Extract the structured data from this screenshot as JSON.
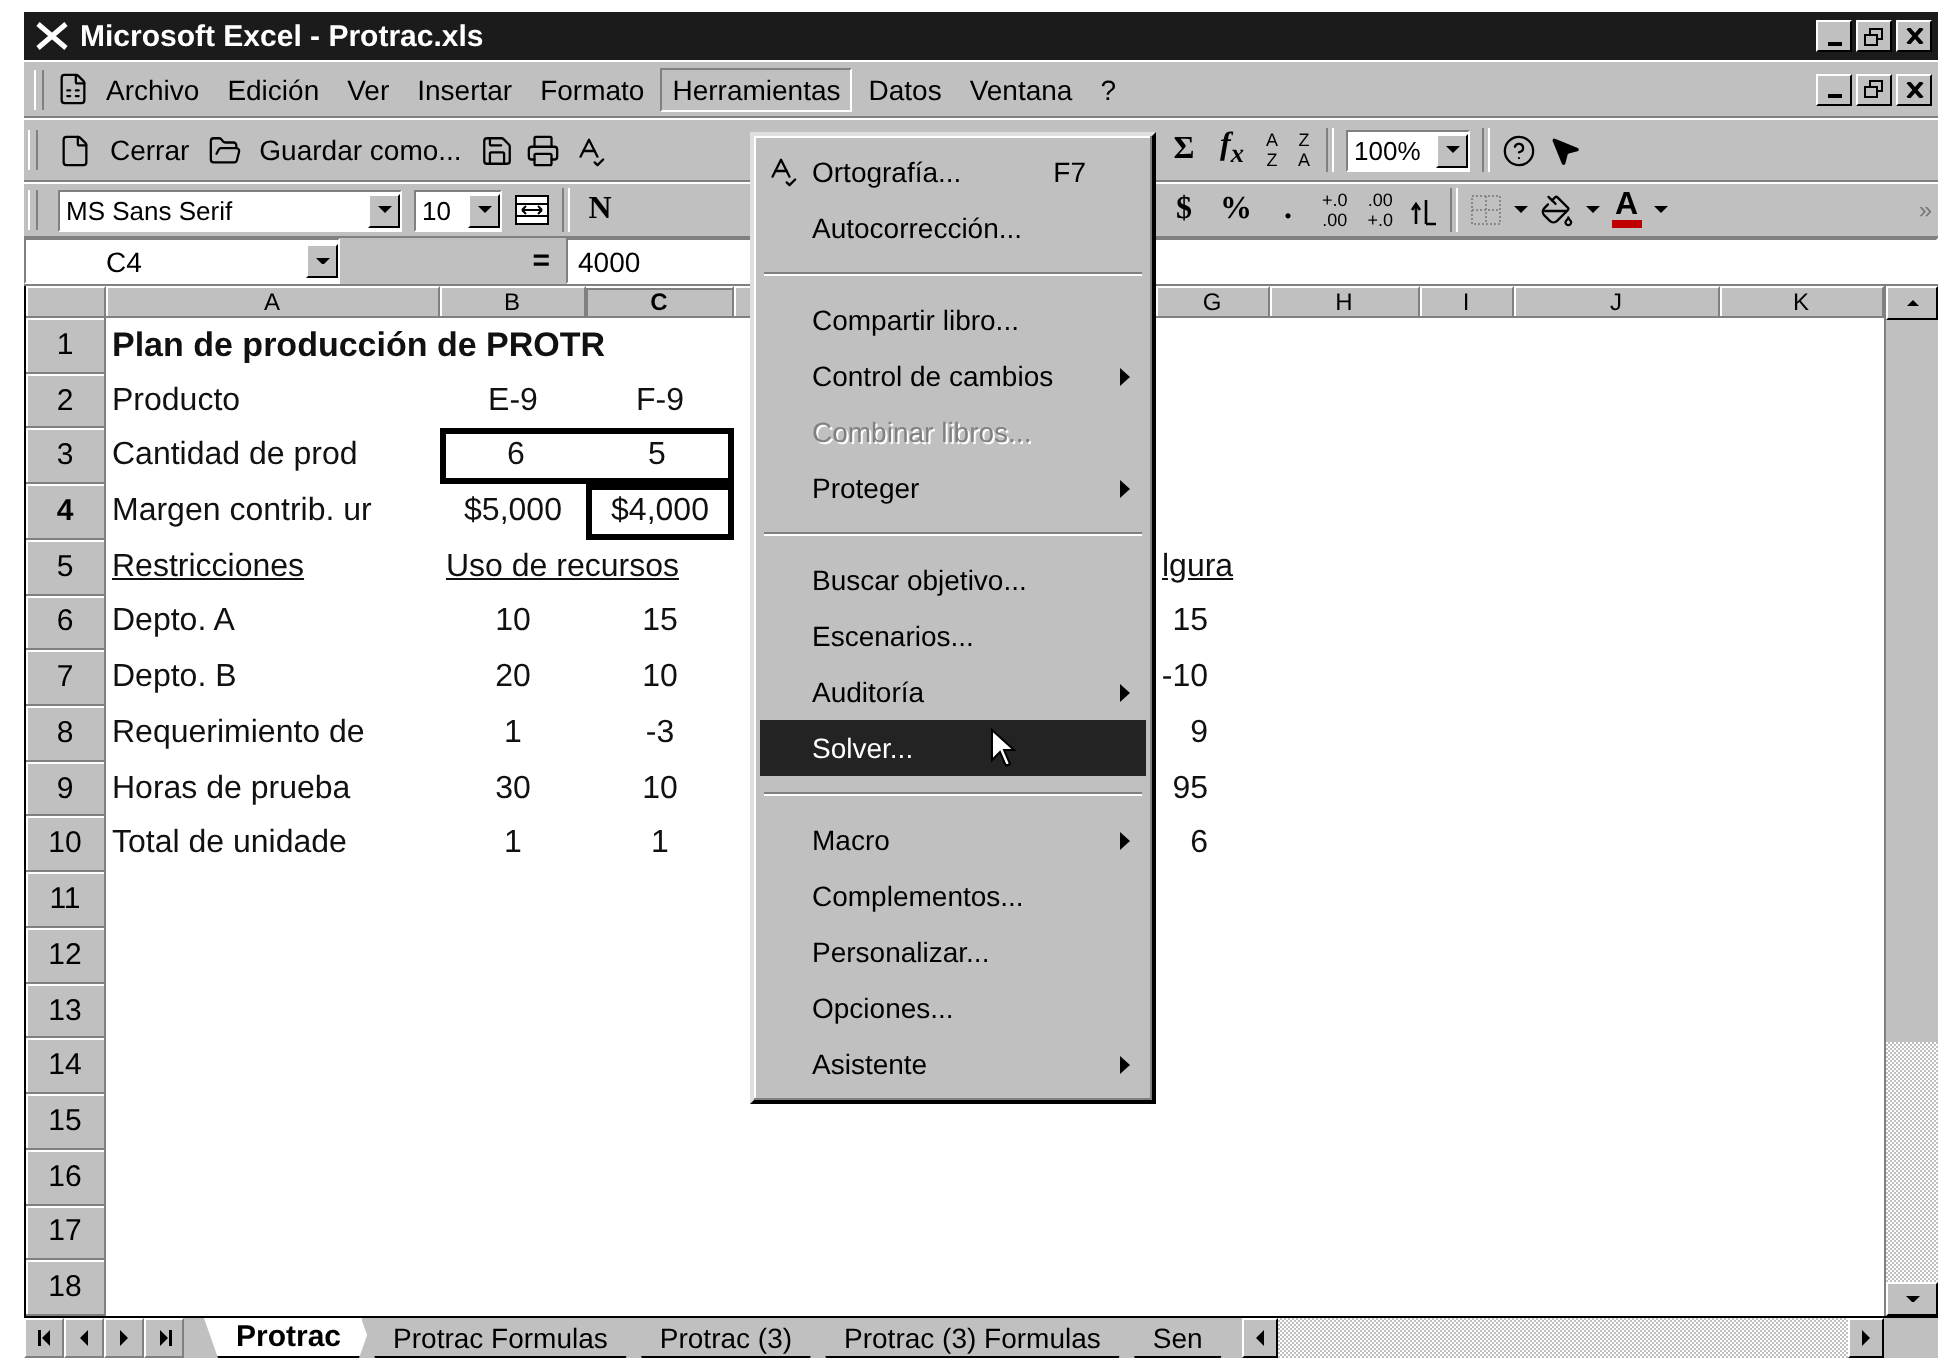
{
  "window": {
    "title": "Microsoft Excel - Protrac.xls"
  },
  "menu_bar": [
    {
      "label": "Archivo",
      "selected": false
    },
    {
      "label": "Edición",
      "selected": false
    },
    {
      "label": "Ver",
      "selected": false
    },
    {
      "label": "Insertar",
      "selected": false
    },
    {
      "label": "Formato",
      "selected": false
    },
    {
      "label": "Herramientas",
      "selected": true
    },
    {
      "label": "Datos",
      "selected": false
    },
    {
      "label": "Ventana",
      "selected": false
    },
    {
      "label": "?",
      "selected": false
    }
  ],
  "toolbar_standard": {
    "close_label": "Cerrar",
    "save_as_label": "Guardar como...",
    "sum": "Σ",
    "function": "f$_{x}$",
    "sort_ascending": [
      "A",
      "Z"
    ],
    "sort_descending": [
      "Z",
      "A"
    ],
    "zoom": "100%"
  },
  "toolbar_format": {
    "font": "MS Sans Serif",
    "size": "10",
    "bold": "N",
    "currency": "$",
    "percent": "%",
    "comma": ".",
    "increase_decimal": [
      "+.0",
      ".00"
    ],
    "decrease_decimal": [
      ".00",
      "+.0"
    ],
    "font_color": "A",
    "more": "»"
  },
  "formula_bar": {
    "name_box": "C4",
    "equals": "=",
    "formula": "4000"
  },
  "sheet": {
    "columns": [
      {
        "label": "A",
        "selected": false
      },
      {
        "label": "B",
        "selected": false
      },
      {
        "label": "C",
        "selected": true
      },
      {
        "label": "G",
        "selected": false
      },
      {
        "label": "H",
        "selected": false
      },
      {
        "label": "I",
        "selected": false
      },
      {
        "label": "J",
        "selected": false
      },
      {
        "label": "K",
        "selected": false
      }
    ],
    "rows": [
      {
        "number": "1",
        "selected": false,
        "kind": "title",
        "cells": [
          {
            "kind": "text",
            "text": "Plan de producción de PROTR",
            "selected": false,
            "boxed": false
          },
          {
            "kind": "spill"
          },
          {
            "kind": "spill"
          }
        ]
      },
      {
        "number": "2",
        "selected": false,
        "kind": "data",
        "cells": [
          {
            "text": "Producto",
            "selected": false,
            "boxed": false
          },
          {
            "text": "E-9",
            "selected": false,
            "boxed": false
          },
          {
            "text": "F-9",
            "selected": false,
            "boxed": false
          }
        ]
      },
      {
        "number": "3",
        "selected": false,
        "kind": "data",
        "cells": [
          {
            "text": "Cantidad de prod",
            "selected": false,
            "boxed": false
          },
          {
            "text": "6",
            "selected": false,
            "boxed": true
          },
          {
            "text": "5",
            "selected": false,
            "boxed": true
          }
        ]
      },
      {
        "number": "4",
        "selected": true,
        "kind": "data",
        "cells": [
          {
            "text": "Margen contrib. ur",
            "selected": false,
            "boxed": false
          },
          {
            "text": "$5,000",
            "selected": false,
            "boxed": false
          },
          {
            "text": "$4,000",
            "selected": true,
            "boxed": false
          }
        ]
      },
      {
        "number": "5",
        "selected": false,
        "kind": "heading",
        "cells": [
          {
            "text": "Restricciones",
            "selected": false,
            "boxed": false
          },
          {
            "text": "Uso de recursos",
            "selected": false,
            "boxed": false
          },
          {
            "kind": "spill"
          },
          {
            "text": "lgura",
            "selected": false,
            "boxed": false
          }
        ]
      },
      {
        "number": "6",
        "selected": false,
        "kind": "data",
        "cells": [
          {
            "text": "Depto. A",
            "selected": false,
            "boxed": false
          },
          {
            "text": "10",
            "selected": false,
            "boxed": false
          },
          {
            "text": "15",
            "selected": false,
            "boxed": false
          },
          {
            "text": "15",
            "selected": false,
            "boxed": false
          }
        ]
      },
      {
        "number": "7",
        "selected": false,
        "kind": "data",
        "cells": [
          {
            "text": "Depto. B",
            "selected": false,
            "boxed": false
          },
          {
            "text": "20",
            "selected": false,
            "boxed": false
          },
          {
            "text": "10",
            "selected": false,
            "boxed": false
          },
          {
            "text": "-10",
            "selected": false,
            "boxed": false
          }
        ]
      },
      {
        "number": "8",
        "selected": false,
        "kind": "data",
        "cells": [
          {
            "text": "Requerimiento de",
            "selected": false,
            "boxed": false
          },
          {
            "text": "1",
            "selected": false,
            "boxed": false
          },
          {
            "text": "-3",
            "selected": false,
            "boxed": false
          },
          {
            "text": "9",
            "selected": false,
            "boxed": false
          }
        ]
      },
      {
        "number": "9",
        "selected": false,
        "kind": "data",
        "cells": [
          {
            "text": "Horas de prueba",
            "selected": false,
            "boxed": false
          },
          {
            "text": "30",
            "selected": false,
            "boxed": false
          },
          {
            "text": "10",
            "selected": false,
            "boxed": false
          },
          {
            "text": "95",
            "selected": false,
            "boxed": false
          }
        ]
      },
      {
        "number": "10",
        "selected": false,
        "kind": "data",
        "cells": [
          {
            "text": "Total de unidade",
            "selected": false,
            "boxed": false
          },
          {
            "text": "1",
            "selected": false,
            "boxed": false
          },
          {
            "text": "1",
            "selected": false,
            "boxed": false
          },
          {
            "text": "6",
            "selected": false,
            "boxed": false
          }
        ]
      },
      {
        "number": "11",
        "selected": false
      },
      {
        "number": "12",
        "selected": false
      },
      {
        "number": "13",
        "selected": false
      },
      {
        "number": "14",
        "selected": false
      },
      {
        "number": "15",
        "selected": false
      },
      {
        "number": "16",
        "selected": false
      },
      {
        "number": "17",
        "selected": false
      },
      {
        "number": "18",
        "selected": false
      }
    ]
  },
  "sheet_tabs": [
    {
      "label": "Protrac",
      "selected": true
    },
    {
      "label": "Protrac Formulas",
      "selected": false
    },
    {
      "label": "Protrac (3)",
      "selected": false
    },
    {
      "label": "Protrac (3) Formulas",
      "selected": false
    },
    {
      "label": "Sen",
      "selected": false
    }
  ],
  "tools_menu": [
    {
      "kind": "icon-item",
      "label": "Ortografía...",
      "shortcut": "F7",
      "disabled": false,
      "submenu": false,
      "selected": false
    },
    {
      "kind": "item",
      "label": "Autocorrección...",
      "disabled": false,
      "submenu": false,
      "selected": false
    },
    {
      "kind": "separator"
    },
    {
      "kind": "item",
      "label": "Compartir libro...",
      "disabled": false,
      "submenu": false,
      "selected": false
    },
    {
      "kind": "item",
      "label": "Control de cambios",
      "disabled": false,
      "submenu": true,
      "selected": false
    },
    {
      "kind": "item",
      "label": "Combinar libros...",
      "disabled": true,
      "submenu": false,
      "selected": false
    },
    {
      "kind": "item",
      "label": "Proteger",
      "disabled": false,
      "submenu": true,
      "selected": false
    },
    {
      "kind": "separator"
    },
    {
      "kind": "item",
      "label": "Buscar objetivo...",
      "disabled": false,
      "submenu": false,
      "selected": false
    },
    {
      "kind": "item",
      "label": "Escenarios...",
      "disabled": false,
      "submenu": false,
      "selected": false
    },
    {
      "kind": "item",
      "label": "Auditoría",
      "disabled": false,
      "submenu": true,
      "selected": false
    },
    {
      "kind": "item",
      "label": "Solver...",
      "disabled": false,
      "submenu": false,
      "selected": true
    },
    {
      "kind": "separator"
    },
    {
      "kind": "item",
      "label": "Macro",
      "disabled": false,
      "submenu": true,
      "selected": false
    },
    {
      "kind": "item",
      "label": "Complementos...",
      "disabled": false,
      "submenu": false,
      "selected": false
    },
    {
      "kind": "item",
      "label": "Personalizar...",
      "disabled": false,
      "submenu": false,
      "selected": false
    },
    {
      "kind": "item",
      "label": "Opciones...",
      "disabled": false,
      "submenu": false,
      "selected": false
    },
    {
      "kind": "item",
      "label": "Asistente",
      "disabled": false,
      "submenu": true,
      "selected": false
    }
  ]
}
